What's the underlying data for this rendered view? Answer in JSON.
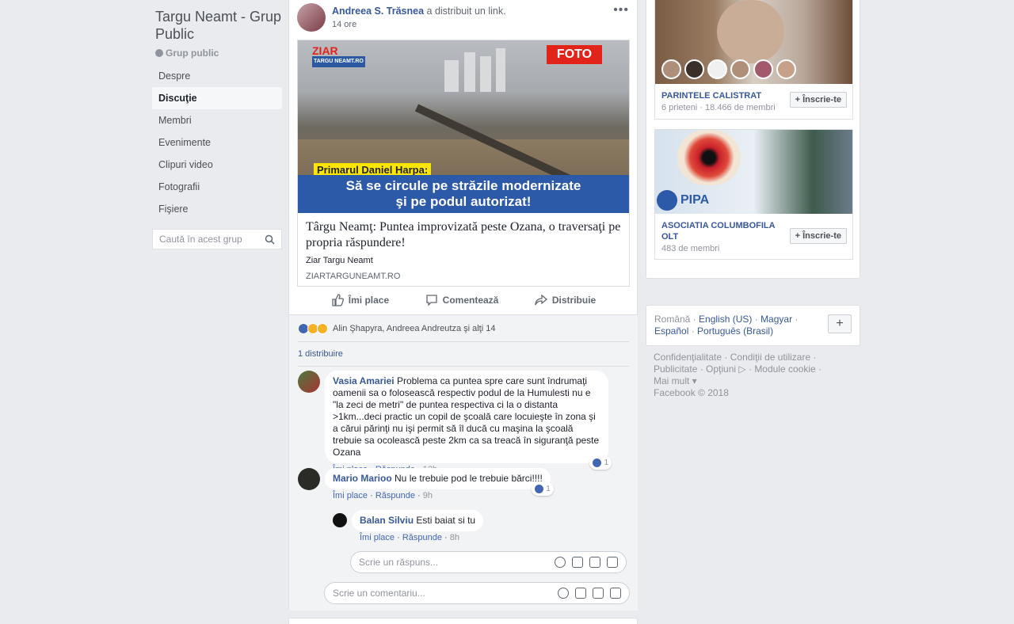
{
  "group": {
    "title": "Targu Neamt - Grup Public",
    "privacy": "Grup public",
    "nav": [
      "Despre",
      "Discuţie",
      "Membri",
      "Evenimente",
      "Clipuri video",
      "Fotografii",
      "Fişiere"
    ],
    "search_placeholder": "Caută în acest grup"
  },
  "post": {
    "author": "Andreea S. Trăsnea",
    "action": "a distribuit un link.",
    "time": "14 ore",
    "menu": "•••",
    "image": {
      "logo": "ZIAR",
      "logo_sub": "TARGU NEAMT.RO",
      "badge": "FOTO",
      "tag": "Primarul Daniel Harpa:",
      "caption_line1": "Să se circule pe străzile modernizate",
      "caption_line2": "şi pe podul autorizat!"
    },
    "link_title": "Târgu Neamţ: Puntea improvizată peste Ozana, o traversaţi pe propria răspundere!",
    "link_source": "Ziar Targu Neamt",
    "link_domain": "ZIARTARGUNEAMT.RO",
    "actions": {
      "like": "Îmi place",
      "comment": "Comentează",
      "share": "Distribuie"
    },
    "reactions_text": "Alin Şhapyra, Andreea Andreutza şi alţi 14",
    "shares_text": "1 distribuire"
  },
  "comments": [
    {
      "name": "Vasia Amariei",
      "text": "Problema ca puntea spre care sunt îndrumaţi oamenii sa o folosească respectiv podul de la Humulesti nu e \"la zeci de metri\" de puntea respectiva ci la o distanta >1km...deci practic un copil de şcoală care locuieşte în zona şi a cărui părinţi nu işi permit să îl ducă cu maşina la şcoală trebuie sa ocolească peste 2km ca sa treacă în siguranţă peste Ozana",
      "like": "Îmi place",
      "reply": "Răspunde",
      "time": "12h",
      "likes": "1"
    },
    {
      "name": "Mario Marioo",
      "text": "Nu le trebuie pod le trebuie bărci!!!!",
      "like": "Îmi place",
      "reply": "Răspunde",
      "time": "9h",
      "likes": "1"
    },
    {
      "name": "Balan Silviu",
      "text": "Esti baiat si tu",
      "like": "Îmi place",
      "reply": "Răspunde",
      "time": "8h"
    }
  ],
  "reply_placeholder": "Scrie un răspuns...",
  "comment_placeholder": "Scrie un comentariu...",
  "suggestions": [
    {
      "name": "PARINTELE CALISTRAT",
      "meta": "6 prieteni · 18.466 de membri",
      "button": "+ Înscrie-te"
    },
    {
      "name": "ASOCIATIA COLUMBOFILA OLT",
      "meta": "483 de membri",
      "button": "+ Înscrie-te",
      "logo_text": "PIPA"
    }
  ],
  "languages": {
    "current": "Română",
    "items": [
      "English (US)",
      "Magyar",
      "Español",
      "Português (Brasil)"
    ],
    "add": "+"
  },
  "footer": {
    "links": [
      "Confidenţialitate",
      "Condiţii de utilizare",
      "Publicitate",
      "Opţiuni",
      "Module cookie",
      "Mai mult"
    ],
    "copyright": "Facebook © 2018"
  },
  "colors": {
    "link": "#385898",
    "accent": "#4267b2",
    "background": "#e9ebee"
  }
}
